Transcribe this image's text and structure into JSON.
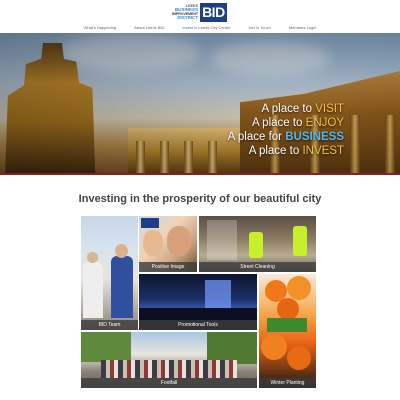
{
  "logo": {
    "line1": "LEEDS",
    "line2": "BUSINESS",
    "line3": "IMPROVEMENT",
    "line4": "DISTRICT",
    "mark": "BID"
  },
  "nav": {
    "items": [
      "What's Happening",
      "About Leeds BID",
      "Invest in Leeds City Centre",
      "Get in Touch",
      "Members Login"
    ]
  },
  "hero": {
    "taglines": [
      {
        "prefix": "A place to ",
        "accent": "VISIT",
        "accent_color": "#f3c24a"
      },
      {
        "prefix": "A place to ",
        "accent": "ENJOY",
        "accent_color": "#f3c24a"
      },
      {
        "prefix": "A place for ",
        "accent": "BUSINESS",
        "accent_color": "#55b8f0"
      },
      {
        "prefix": "A place to ",
        "accent": "INVEST",
        "accent_color": "#f3c24a"
      }
    ]
  },
  "section": {
    "title": "Investing in the prosperity of our beautiful city"
  },
  "tiles": {
    "positive_image": "Positive Image",
    "street_cleaning": "Street Cleaning",
    "bid_team": "BID Team",
    "promotional_tools": "Promotional Tools",
    "winter_planting": "Winter Planting",
    "footfall": "Footfall"
  },
  "colors": {
    "logo_blue": "#1d3f86",
    "accent_gold": "#f3c24a",
    "accent_blue": "#55b8f0",
    "hero_rule": "#8a1f1f"
  }
}
